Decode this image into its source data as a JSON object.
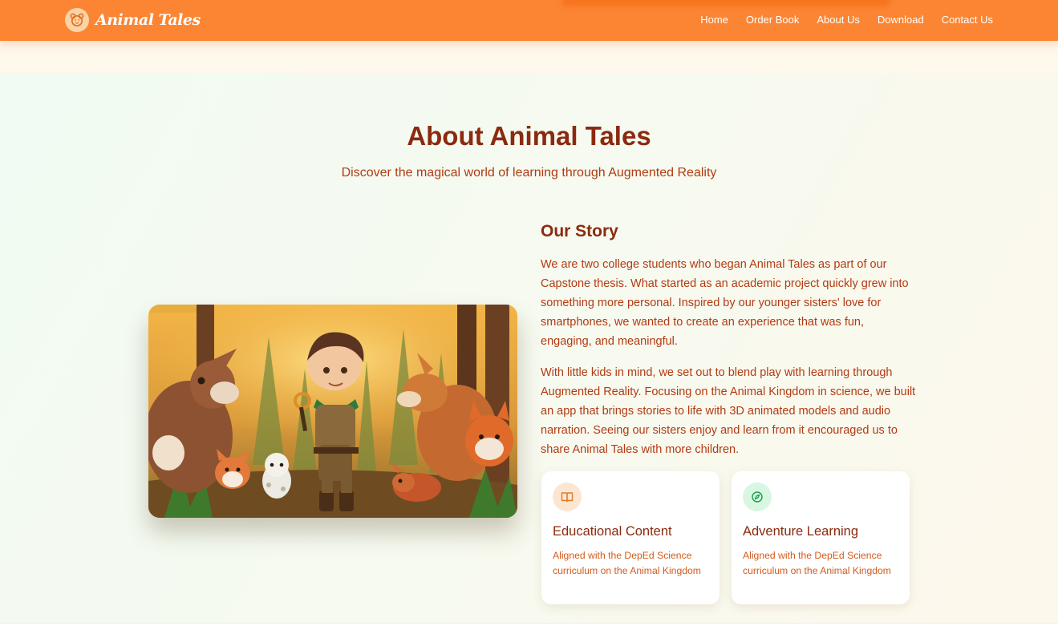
{
  "nav": {
    "brand": "Animal Tales",
    "brand_icon": "bear-face-icon",
    "links": [
      "Home",
      "Order Book",
      "About Us",
      "Download",
      "Contact Us"
    ]
  },
  "about": {
    "title": "About Animal Tales",
    "subtitle": "Discover the magical world of learning through Augmented Reality"
  },
  "story": {
    "title": "Our Story",
    "paragraphs": [
      "We are two college students who began Animal Tales as part of our Capstone thesis. What started as an academic project quickly grew into something more personal. Inspired by our younger sisters' love for smartphones, we wanted to create an experience that was fun, engaging, and meaningful.",
      "With little kids in mind, we set out to blend play with learning through Augmented Reality. Focusing on the Animal Kingdom in science, we built an app that brings stories to life with 3D animated models and audio narration. Seeing our sisters enjoy and learn from it encouraged us to share Animal Tales with more children."
    ]
  },
  "features": [
    {
      "title": "Educational Content",
      "description": "Aligned with the DepEd Science curriculum on the Animal Kingdom",
      "icon": "book-open-icon"
    },
    {
      "title": "Adventure Learning",
      "description": "Aligned with the DepEd Science curriculum on the Animal Kingdom",
      "icon": "compass-icon"
    }
  ],
  "image": {
    "description_icon": "forest-explorer-illustration"
  },
  "colors": {
    "nav_bg": "#fb8533",
    "heading": "#8b2a0f",
    "body_text": "#b23b13",
    "card_text": "#d35a1c"
  }
}
